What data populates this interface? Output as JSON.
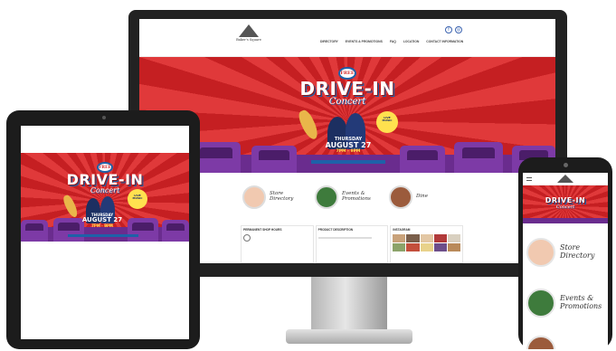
{
  "colors": {
    "red": "#d42a2a",
    "purple": "#6a2c8e",
    "blue": "#1e61a8",
    "yellow": "#ffe14f"
  },
  "poster": {
    "free": "FREE",
    "drive_in": "DRIVE-IN",
    "concert": "Concert",
    "weekday": "THURSDAY",
    "date": "AUGUST 27",
    "time": "7PM - 9PM"
  },
  "desktop": {
    "logo_text": "Baker's Square",
    "menu": [
      "DIRECTORY",
      "EVENTS & PROMOTIONS",
      "FAQ",
      "LOCATION",
      "CONTACT INFORMATION"
    ],
    "shortcuts": [
      {
        "label": "Store Directory",
        "icon": "store-photo"
      },
      {
        "label": "Events & Promotions",
        "icon": "events-photo"
      },
      {
        "label": "Dine",
        "icon": "dine-photo"
      }
    ],
    "info_titles": [
      "PERMANENT SHOP HOURS",
      "PRODUCT DESCRIPTION",
      "INSTAGRAM"
    ]
  },
  "phone": {
    "items": [
      {
        "label_line1": "Store",
        "label_line2": "Directory"
      },
      {
        "label_line1": "Events &",
        "label_line2": "Promotions"
      }
    ]
  }
}
